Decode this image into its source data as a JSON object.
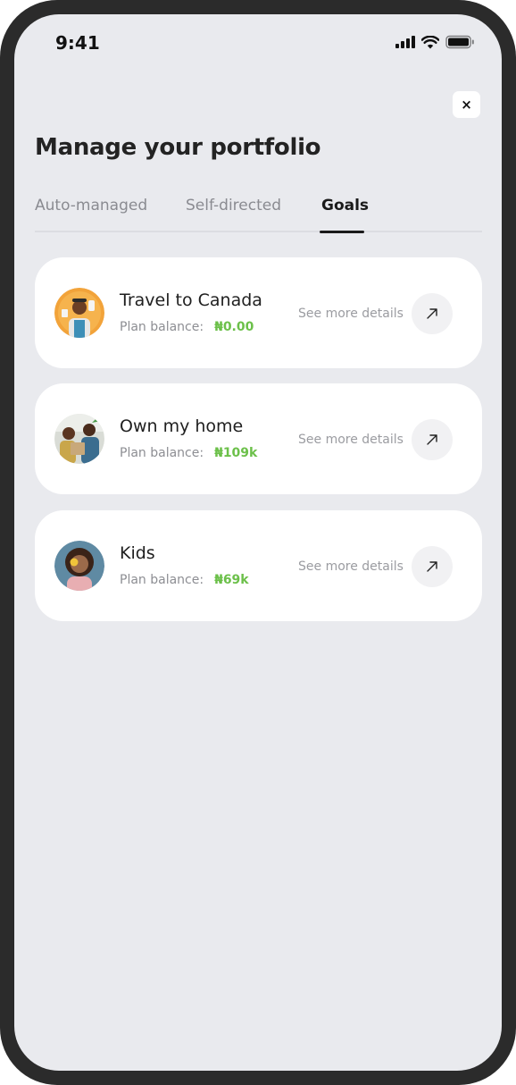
{
  "status_bar": {
    "time": "9:41"
  },
  "header": {
    "close_label": "×",
    "title": "Manage your portfolio"
  },
  "tabs": [
    {
      "label": "Auto-managed",
      "active": false
    },
    {
      "label": "Self-directed",
      "active": false
    },
    {
      "label": "Goals",
      "active": true
    }
  ],
  "goals": [
    {
      "title": "Travel to Canada",
      "balance_label": "Plan balance:",
      "balance": "₦0.00",
      "details": "See more details",
      "avatar_icon": "traveler-avatar"
    },
    {
      "title": "Own my home",
      "balance_label": "Plan balance:",
      "balance": "₦109k",
      "details": "See more details",
      "avatar_icon": "couple-moving-avatar"
    },
    {
      "title": "Kids",
      "balance_label": "Plan balance:",
      "balance": "₦69k",
      "details": "See more details",
      "avatar_icon": "child-avatar"
    }
  ],
  "colors": {
    "background": "#e9eaee",
    "card": "#ffffff",
    "balance_green": "#6cc04a",
    "active_tab": "#1a1a1a"
  }
}
